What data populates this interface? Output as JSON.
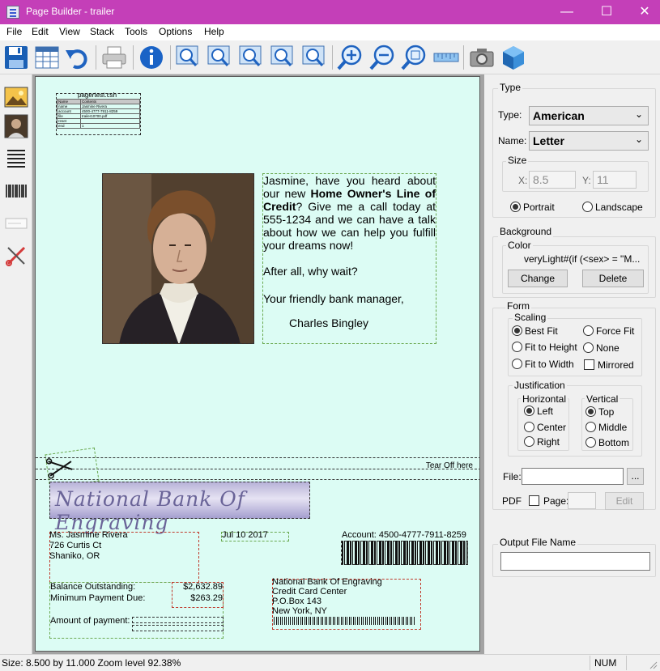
{
  "window": {
    "title": "Page Builder - trailer"
  },
  "menu": [
    "File",
    "Edit",
    "View",
    "Stack",
    "Tools",
    "Options",
    "Help"
  ],
  "toolbar": [
    "save-icon",
    "table-icon",
    "undo-icon",
    "print-icon",
    "info-icon",
    "zoom-page-1-icon",
    "zoom-page-2-icon",
    "zoom-page-3-icon",
    "zoom-page-4-icon",
    "zoom-page-5-icon",
    "zoom-in-icon",
    "zoom-out-icon",
    "zoom-fit-icon",
    "ruler-icon",
    "camera-icon",
    "cube-icon"
  ],
  "leftTools": [
    "landscape-image-icon",
    "portrait-image-icon",
    "text-lines-icon",
    "barcode-icon",
    "blank-field-icon",
    "cut-tool-icon"
  ],
  "page": {
    "fieldTable": {
      "title": "pagertest.csh",
      "rows": [
        [
          "Name",
          "Contents"
        ],
        [
          "name",
          "Jasmine Rivera"
        ],
        [
          "account",
          "4500-4777-7911-8259"
        ],
        [
          "file",
          "trailer10700.pdf"
        ],
        [
          "reset",
          ""
        ],
        [
          "end",
          "1"
        ]
      ]
    },
    "letter": {
      "p1_a": "Jasmine, have you heard about our new ",
      "p1_bold": "Home Owner's Line of Credit",
      "p1_b": "? Give me a call today at 555-1234 and we can have a talk about how we can help you fulfill your dreams now!",
      "p2": "After all, why wait?",
      "p3": "Your friendly bank manager,",
      "signature": "Charles Bingley"
    },
    "tearOff": "Tear Off here",
    "bankLogo": "National Bank Of Engraving",
    "address": [
      "Ms. Jasmine Rivera",
      "726 Curtis Ct",
      "Shaniko, OR"
    ],
    "date": "Jul 10 2017",
    "account": "Account: 4500-4777-7911-8259",
    "balanceLabel": "Balance Outstanding:",
    "balanceValue": "$2,632.89",
    "minLabel": "Minimum Payment Due:",
    "minValue": "$263.29",
    "amountLabel": "Amount of payment:",
    "remit": [
      "National Bank Of Engraving",
      "Credit Card Center",
      "P.O.Box 143",
      "New York, NY"
    ]
  },
  "panel": {
    "typeGroup": "Type",
    "typeLabel": "Type:",
    "typeValue": "American",
    "nameLabel": "Name:",
    "nameValue": "Letter",
    "sizeGroup": "Size",
    "xLabel": "X:",
    "xValue": "8.5",
    "yLabel": "Y:",
    "yValue": "11",
    "portrait": "Portrait",
    "landscape": "Landscape",
    "backgroundGroup": "Background",
    "colorGroup": "Color",
    "colorExpr": "veryLight#(if (<sex> = \"M...",
    "changeBtn": "Change",
    "deleteBtn": "Delete",
    "formGroup": "Form",
    "scalingGroup": "Scaling",
    "bestFit": "Best Fit",
    "forceFit": "Force Fit",
    "fitHeight": "Fit to Height",
    "none": "None",
    "fitWidth": "Fit to Width",
    "mirrored": "Mirrored",
    "justGroup": "Justification",
    "horizGroup": "Horizontal",
    "left": "Left",
    "center": "Center",
    "right": "Right",
    "vertGroup": "Vertical",
    "top": "Top",
    "middle": "Middle",
    "bottom": "Bottom",
    "fileLabel": "File:",
    "fileValue": "",
    "browseBtn": "...",
    "pdfLabel": "PDF",
    "pageLabel": "Page:",
    "editBtn": "Edit",
    "outputGroup": "Output File Name",
    "outputValue": ""
  },
  "status": {
    "left": "Size: 8.500 by 11.000  Zoom level 92.38%",
    "num": "NUM"
  }
}
